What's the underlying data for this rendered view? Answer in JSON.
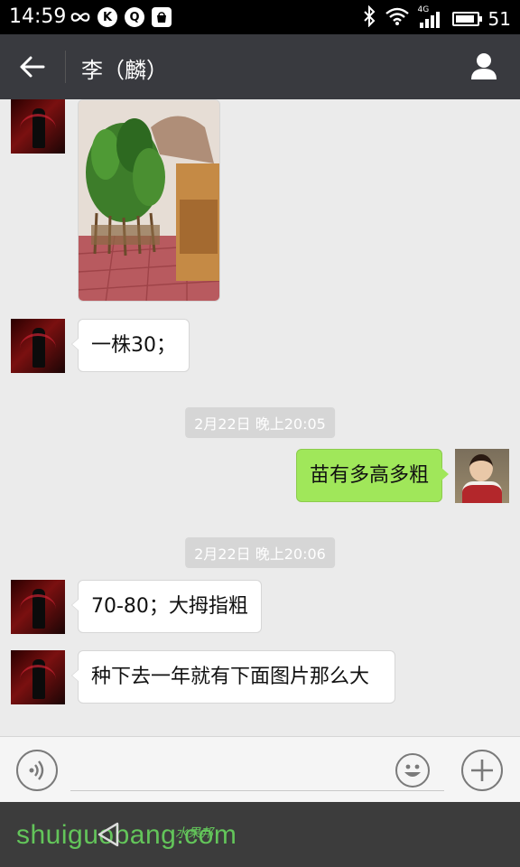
{
  "status_bar": {
    "time": "14:59",
    "battery": "51",
    "network": "4G",
    "left_icons": [
      "infinity-icon",
      "k-icon",
      "q-icon",
      "bag-icon"
    ],
    "k_letter": "K",
    "q_letter": "Q"
  },
  "header": {
    "title": "李（麟）",
    "back_icon": "arrow-left-icon",
    "profile_icon": "person-icon"
  },
  "messages": [
    {
      "type": "image",
      "side": "left",
      "description_icon": "plant-photo"
    },
    {
      "type": "text",
      "side": "left",
      "text": "一株30；"
    },
    {
      "type": "timestamp",
      "text": "2月22日 晚上20:05"
    },
    {
      "type": "text",
      "side": "right",
      "text": "苗有多高多粗"
    },
    {
      "type": "timestamp",
      "text": "2月22日 晚上20:06"
    },
    {
      "type": "text",
      "side": "left",
      "text": "70-80；大拇指粗"
    },
    {
      "type": "text",
      "side": "left",
      "text": "种下去一年就有下面图片那么大"
    }
  ],
  "input_bar": {
    "placeholder": "",
    "voice_icon": "voice-icon",
    "emoji_icon": "smiley-icon",
    "plus_icon": "plus-icon"
  },
  "watermark": {
    "main": "shuiguobang.com",
    "sub": "水果邦"
  },
  "colors": {
    "header_bg": "#393a3f",
    "chat_bg": "#ebebeb",
    "bubble_mine": "#a0e75a",
    "bubble_other": "#ffffff",
    "watermark": "#63c55a"
  }
}
